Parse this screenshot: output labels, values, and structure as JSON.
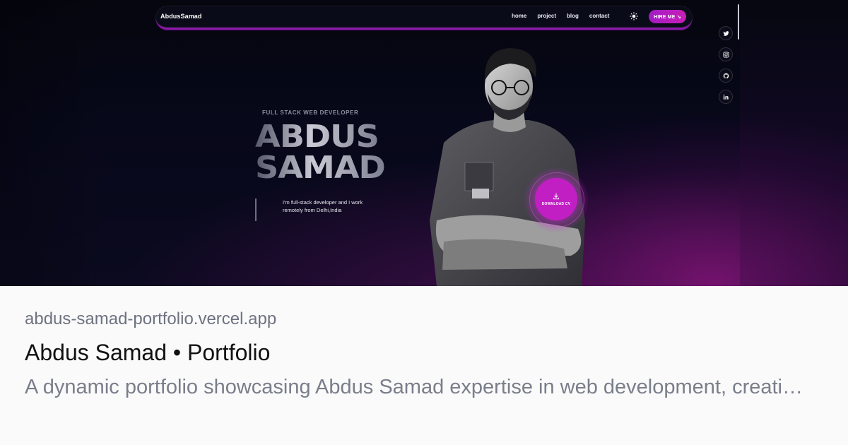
{
  "site": {
    "logo": "AbdusSamad",
    "nav_links": [
      "home",
      "project",
      "blog",
      "contact"
    ],
    "theme_toggle_icon": "sun-icon",
    "hire_button": "HIRE ME ↘",
    "accent_color": "#c11fc4"
  },
  "social": [
    {
      "name": "twitter-icon"
    },
    {
      "name": "instagram-icon"
    },
    {
      "name": "github-icon"
    },
    {
      "name": "linkedin-icon"
    }
  ],
  "hero": {
    "subtitle": "FULL STACK WEB DEVELOPER",
    "name_line1": "ABDUS",
    "name_line2": "SAMAD",
    "description": "I'm full-stack developer and I work remotely from Delhi,India",
    "download_button": "DOWNLOAD CV",
    "download_icon": "download-icon"
  },
  "preview": {
    "domain": "abdus-samad-portfolio.vercel.app",
    "title": "Abdus Samad • Portfolio",
    "description": "A dynamic portfolio showcasing Abdus Samad expertise in web development, creati…"
  }
}
